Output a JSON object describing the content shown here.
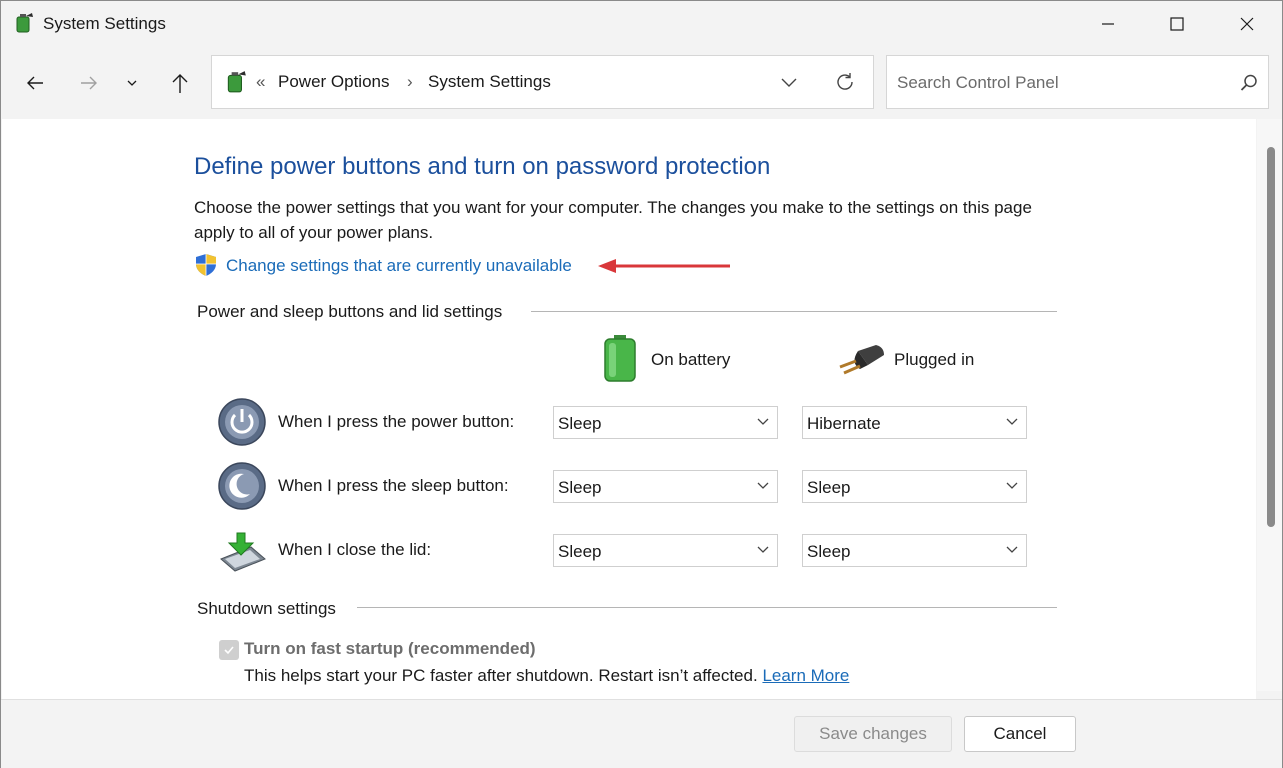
{
  "window": {
    "title": "System Settings"
  },
  "breadcrumb": {
    "separator": "«",
    "items": [
      "Power Options",
      "System Settings"
    ],
    "chevron": "›"
  },
  "search": {
    "placeholder": "Search Control Panel"
  },
  "page": {
    "title": "Define power buttons and turn on password protection",
    "description": "Choose the power settings that you want for your computer. The changes you make to the settings on this page apply to all of your power plans.",
    "change_link": "Change settings that are currently unavailable"
  },
  "power_section": {
    "label": "Power and sleep buttons and lid settings",
    "columns": [
      "On battery",
      "Plugged in"
    ],
    "rows": [
      {
        "label": "When I press the power button:",
        "on_battery": "Sleep",
        "plugged_in": "Hibernate"
      },
      {
        "label": "When I press the sleep button:",
        "on_battery": "Sleep",
        "plugged_in": "Sleep"
      },
      {
        "label": "When I close the lid:",
        "on_battery": "Sleep",
        "plugged_in": "Sleep"
      }
    ]
  },
  "shutdown_section": {
    "label": "Shutdown settings",
    "fast_startup": {
      "label": "Turn on fast startup (recommended)",
      "checked": true,
      "disabled": true
    },
    "help_text": "This helps start your PC faster after shutdown. Restart isn’t affected.",
    "learn_more": "Learn More"
  },
  "footer": {
    "save_label": "Save changes",
    "cancel_label": "Cancel"
  },
  "colors": {
    "title_blue": "#1b4f9c",
    "link_blue": "#1a6bb8",
    "arrow_red": "#d9373a"
  }
}
